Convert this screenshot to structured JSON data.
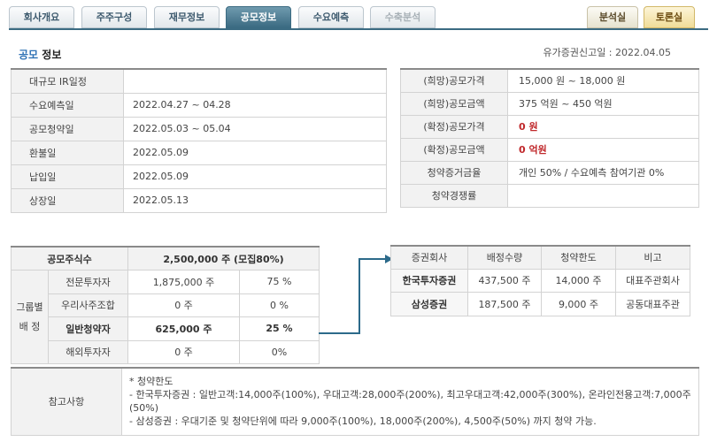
{
  "tabs": {
    "left": [
      {
        "label": "회사개요",
        "state": "normal"
      },
      {
        "label": "주주구성",
        "state": "normal"
      },
      {
        "label": "재무정보",
        "state": "normal"
      },
      {
        "label": "공모정보",
        "state": "active"
      },
      {
        "label": "수요예측",
        "state": "normal"
      },
      {
        "label": "수축분석",
        "state": "disabled"
      }
    ],
    "right": [
      {
        "label": "분석실"
      },
      {
        "label": "토론실"
      }
    ]
  },
  "header": {
    "title_highlight": "공모",
    "title_rest": "정보",
    "filing_date": "유가증권신고일 : 2022.04.05"
  },
  "schedule": [
    {
      "label": "대규모 IR일정",
      "value": ""
    },
    {
      "label": "수요예측일",
      "value": "2022.04.27 ~ 04.28"
    },
    {
      "label": "공모청약일",
      "value": "2022.05.03 ~ 05.04"
    },
    {
      "label": "환불일",
      "value": "2022.05.09"
    },
    {
      "label": "납입일",
      "value": "2022.05.09"
    },
    {
      "label": "상장일",
      "value": "2022.05.13"
    }
  ],
  "offering": [
    {
      "label": "(희망)공모가격",
      "value": "15,000 원 ~ 18,000 원",
      "emph": false
    },
    {
      "label": "(희망)공모금액",
      "value": "375 억원   ~  450 억원",
      "emph": false
    },
    {
      "label": "(확정)공모가격",
      "value": "0 원",
      "emph": true
    },
    {
      "label": "(확정)공모금액",
      "value": "0 억원",
      "emph": true
    },
    {
      "label": "청약증거금율",
      "value": "개인 50% / 수요예측 참여기관 0%",
      "emph": false
    },
    {
      "label": "청약경쟁률",
      "value": "",
      "emph": false
    }
  ],
  "shares": {
    "header_label": "공모주식수",
    "header_value": "2,500,000 주 (모집80%)",
    "group_label_1": "그룹별",
    "group_label_2": "배 정",
    "rows": [
      {
        "label": "전문투자자",
        "shares": "1,875,000 주",
        "pct": "75 %",
        "bold": false
      },
      {
        "label": "우리사주조합",
        "shares": "0 주",
        "pct": "0 %",
        "bold": false
      },
      {
        "label": "일반청약자",
        "shares": "625,000 주",
        "pct": "25 %",
        "bold": true
      },
      {
        "label": "해외투자자",
        "shares": "0 주",
        "pct": "0%",
        "bold": false
      }
    ]
  },
  "brokers": {
    "headers": [
      "증권회사",
      "배정수량",
      "청약한도",
      "비고"
    ],
    "rows": [
      {
        "name": "한국투자증권",
        "qty": "437,500 주",
        "limit": "14,000 주",
        "note": "대표주관회사"
      },
      {
        "name": "삼성증권",
        "qty": "187,500 주",
        "limit": "9,000 주",
        "note": "공동대표주관"
      }
    ]
  },
  "reference": {
    "label": "참고사항",
    "lines": [
      "* 청약한도",
      "- 한국투자증권 : 일반고객:14,000주(100%), 우대고객:28,000주(200%), 최고우대고객:42,000주(300%), 온라인전용고객:7,000주(50%)",
      "- 삼성증권 : 우대기준 및 청약단위에 따라 9,000주(100%), 18,000주(200%), 4,500주(50%) 까지 청약 가능."
    ]
  },
  "colors": {
    "active_tab": "#3b6b82",
    "title_accent": "#2f72b5",
    "emphasis_red": "#c0282b",
    "arrow": "#2c6a8a"
  }
}
